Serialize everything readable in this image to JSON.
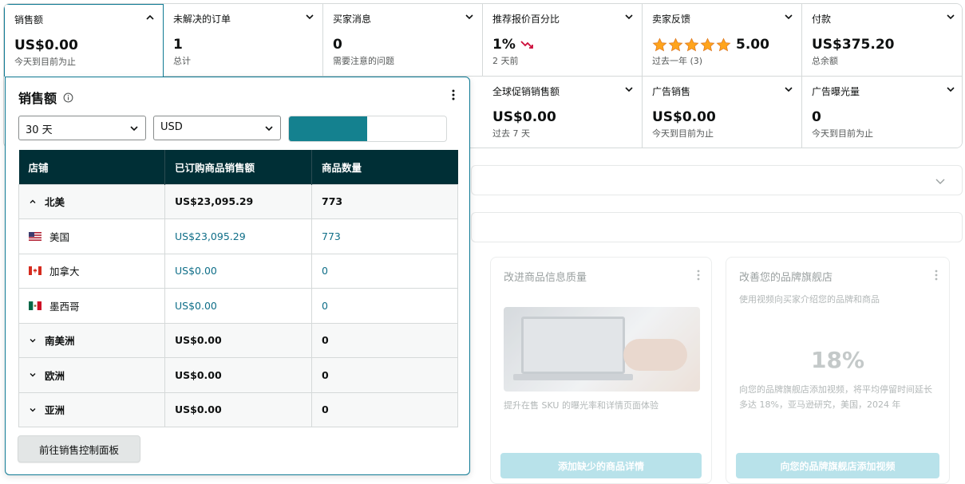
{
  "tiles": [
    {
      "title": "销售额",
      "value": "US$0.00",
      "sub": "今天到目前为止"
    },
    {
      "title": "未解决的订单",
      "value": "1",
      "sub": "总计"
    },
    {
      "title": "买家消息",
      "value": "0",
      "sub": "需要注意的问题"
    },
    {
      "title": "推荐报价百分比",
      "value": "1%",
      "sub": "2 天前",
      "trend_icon": "trend-down-icon"
    },
    {
      "title": "卖家反馈",
      "value": "5.00",
      "sub": "过去一年 (3)",
      "rating": 5
    },
    {
      "title": "付款",
      "value": "US$375.20",
      "sub": "总余额"
    },
    {
      "title": "全球促销销售额",
      "value": "US$0.00",
      "sub": "过去 7 天"
    },
    {
      "title": "广告销售",
      "value": "US$0.00",
      "sub": "今天到目前为止"
    },
    {
      "title": "广告曝光量",
      "value": "0",
      "sub": "今天到目前为止"
    }
  ],
  "popover": {
    "title": "销售额",
    "period": "30 天",
    "currency": "USD",
    "columns": [
      "店铺",
      "已订购商品销售额",
      "商品数量"
    ],
    "rows": [
      {
        "type": "region",
        "expanded": true,
        "name": "北美",
        "sales": "US$23,095.29",
        "qty": "773"
      },
      {
        "type": "country",
        "flag": "us",
        "name": "美国",
        "sales": "US$23,095.29",
        "qty": "773"
      },
      {
        "type": "country",
        "flag": "ca",
        "name": "加拿大",
        "sales": "US$0.00",
        "qty": "0"
      },
      {
        "type": "country",
        "flag": "mx",
        "name": "墨西哥",
        "sales": "US$0.00",
        "qty": "0"
      },
      {
        "type": "region",
        "expanded": false,
        "name": "南美洲",
        "sales": "US$0.00",
        "qty": "0"
      },
      {
        "type": "region",
        "expanded": false,
        "name": "欧洲",
        "sales": "US$0.00",
        "qty": "0"
      },
      {
        "type": "region",
        "expanded": false,
        "name": "亚洲",
        "sales": "US$0.00",
        "qty": "0"
      }
    ],
    "button": "前往销售控制面板"
  },
  "cards": [
    {
      "title": "改进商品信息质量",
      "text": "提升在售 SKU 的曝光率和详情页面体验",
      "button": "添加缺少的商品详情"
    },
    {
      "title": "改善您的品牌旗舰店",
      "subtitle": "使用视频向买家介绍您的品牌和商品",
      "stat": "18%",
      "text": "向您的品牌旗舰店添加视频，将平均停留时间延长多达 18%，亚马逊研究，美国，2024 年",
      "button": "向您的品牌旗舰店添加视频"
    }
  ],
  "colors": {
    "accent": "#0f7a94",
    "header_bg": "#002f36",
    "link": "#0f6e88",
    "star": "#ffa41c"
  }
}
